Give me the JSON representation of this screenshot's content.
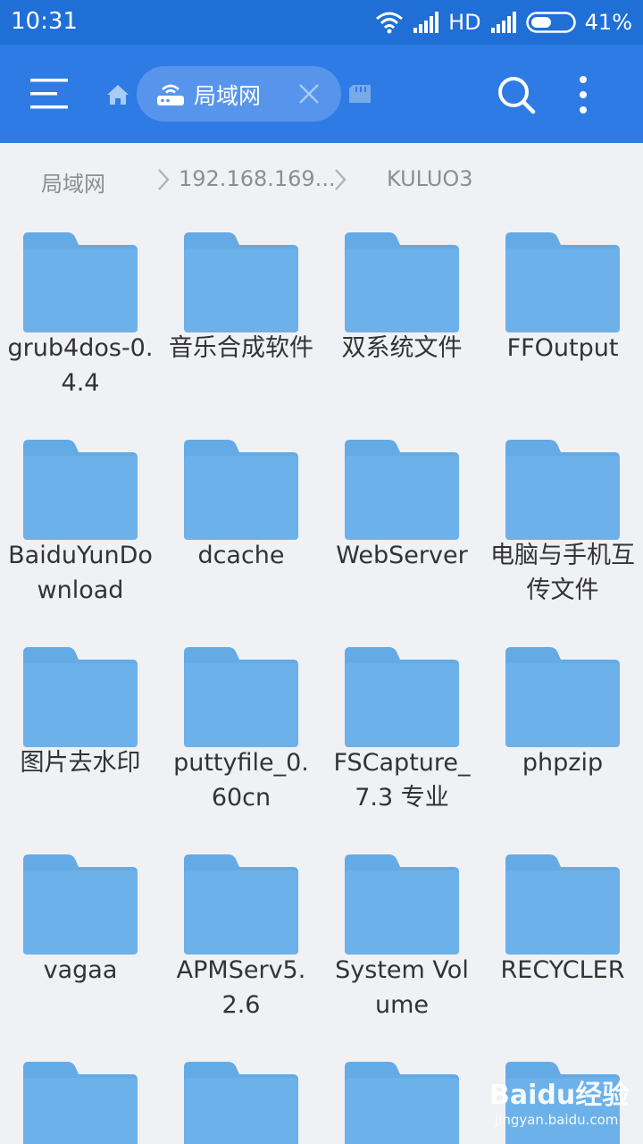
{
  "status_bar": {
    "time": "10:31",
    "network": "HD",
    "battery": "41%"
  },
  "toolbar": {
    "tab_label": "局域网"
  },
  "breadcrumb": [
    "局域网",
    "192.168.169...",
    "KULUO3"
  ],
  "folders": [
    {
      "name": "grub4dos-0.4.4"
    },
    {
      "name": "音乐合成软件"
    },
    {
      "name": "双系统文件"
    },
    {
      "name": "FFOutput"
    },
    {
      "name": "BaiduYunDownload"
    },
    {
      "name": "dcache"
    },
    {
      "name": "WebServer"
    },
    {
      "name": "电脑与手机互传文件"
    },
    {
      "name": "图片去水印"
    },
    {
      "name": "puttyfile_0.60cn"
    },
    {
      "name": "FSCapture_7.3 专业"
    },
    {
      "name": "phpzip"
    },
    {
      "name": "vagaa"
    },
    {
      "name": "APMServ5.2.6"
    },
    {
      "name": "System Volume"
    },
    {
      "name": "RECYCLER"
    },
    {
      "name": ""
    },
    {
      "name": ""
    },
    {
      "name": ""
    },
    {
      "name": ""
    }
  ],
  "watermark": {
    "logo_text": "Baidu经验",
    "url": "jingyan.baidu.com"
  },
  "colors": {
    "status_bar": "#1f6fd6",
    "toolbar": "#2f7be5",
    "folder": "#64abe6",
    "folder_tab": "#64abe6",
    "background": "#f0f1f4"
  }
}
